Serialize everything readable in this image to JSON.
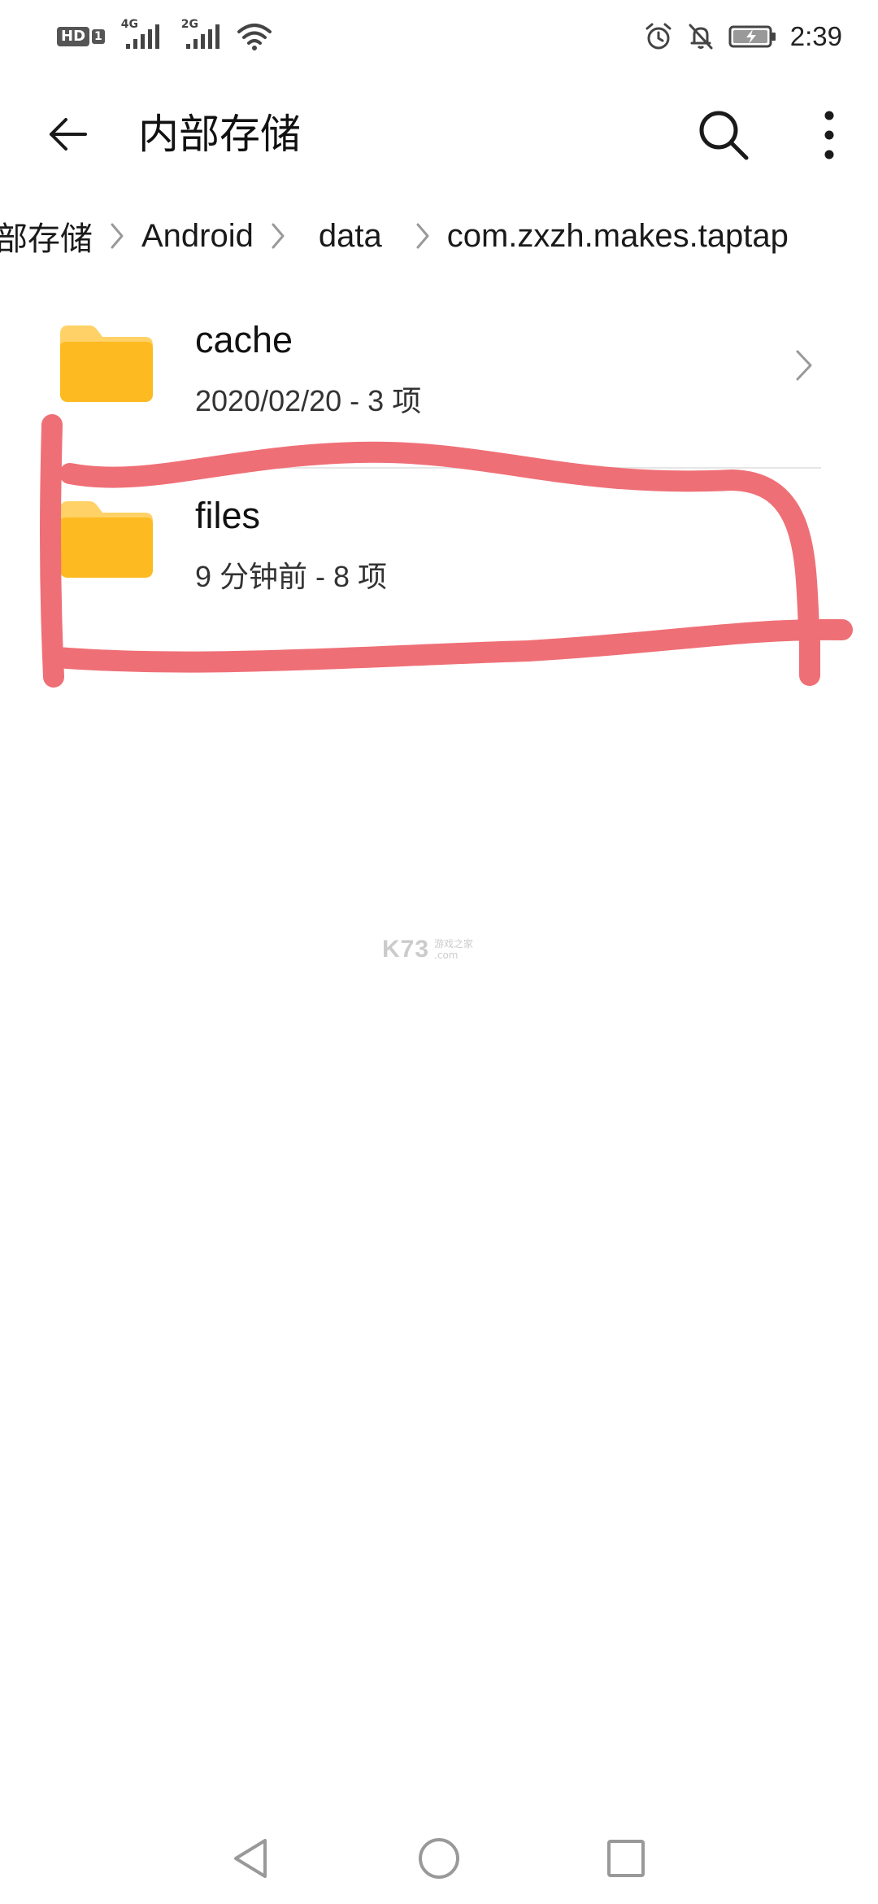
{
  "status_bar": {
    "hd_label": "HD",
    "hd_sub": "1",
    "net1_label": "4G",
    "net2_label": "2G",
    "time": "2:39"
  },
  "app_bar": {
    "title": "内部存储"
  },
  "breadcrumb": [
    {
      "label": "部存储"
    },
    {
      "label": "Android"
    },
    {
      "label": "data"
    },
    {
      "label": "com.zxzh.makes.taptap"
    }
  ],
  "files": [
    {
      "name": "cache",
      "meta": "2020/02/20 - 3 项"
    },
    {
      "name": "files",
      "meta": "9 分钟前 - 8 项"
    }
  ],
  "watermark": {
    "main": "K73",
    "sub": "游戏之家",
    "domain": ".com"
  },
  "colors": {
    "folder_back": "#FFD166",
    "folder_front": "#FDBA21",
    "annotation": "#EF6F76",
    "icon_gray": "#222222"
  }
}
